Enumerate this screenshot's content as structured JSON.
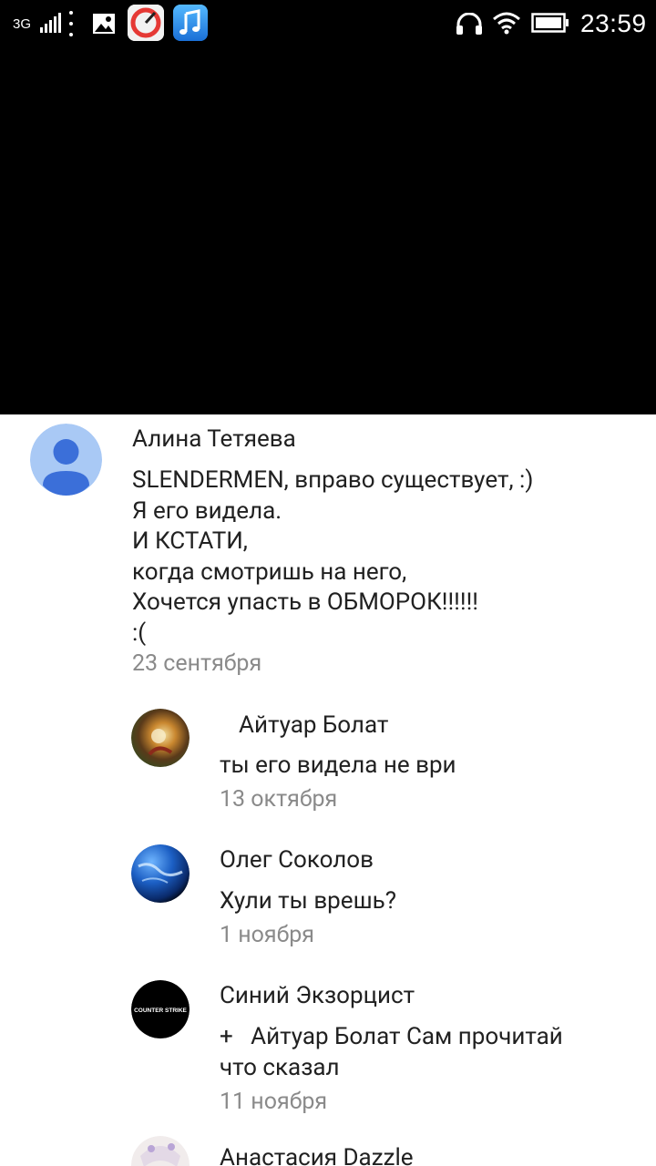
{
  "status_bar": {
    "network": "3G",
    "time": "23:59"
  },
  "comments": [
    {
      "author": "Алина Тетяева",
      "text": "SLENDERMEN, вправо существует, :)\nЯ его видела.\nИ КСТАТИ,\nкогда смотришь на него,\nХочется упасть в ОБМОРОК!!!!!!\n:(",
      "date": "23 сентября",
      "avatar": "default-person-icon"
    }
  ],
  "replies": [
    {
      "author": "Айтуар Болат",
      "text": "ты его видела не ври",
      "date": "13 октября",
      "avatar": "photo-avatar"
    },
    {
      "author": "Олег Соколов",
      "text": "Хули ты врешь?",
      "date": "1 ноября",
      "avatar": "earth-photo-avatar"
    },
    {
      "author": "Синий Экзорцист",
      "mention_prefix": "+",
      "text": "Айтуар Болат Сам прочитай\nчто сказал",
      "date": "11 ноября",
      "avatar": "counter-strike-logo-avatar",
      "avatar_text": "COUNTER STRIKE"
    },
    {
      "author": "Анастасия Dazzle",
      "avatar": "anime-avatar"
    }
  ],
  "colors": {
    "primary_text": "#212121",
    "secondary_text": "#8a8a8a",
    "default_avatar_bg": "#a9c9f5",
    "default_avatar_fg": "#3b6fd9"
  }
}
